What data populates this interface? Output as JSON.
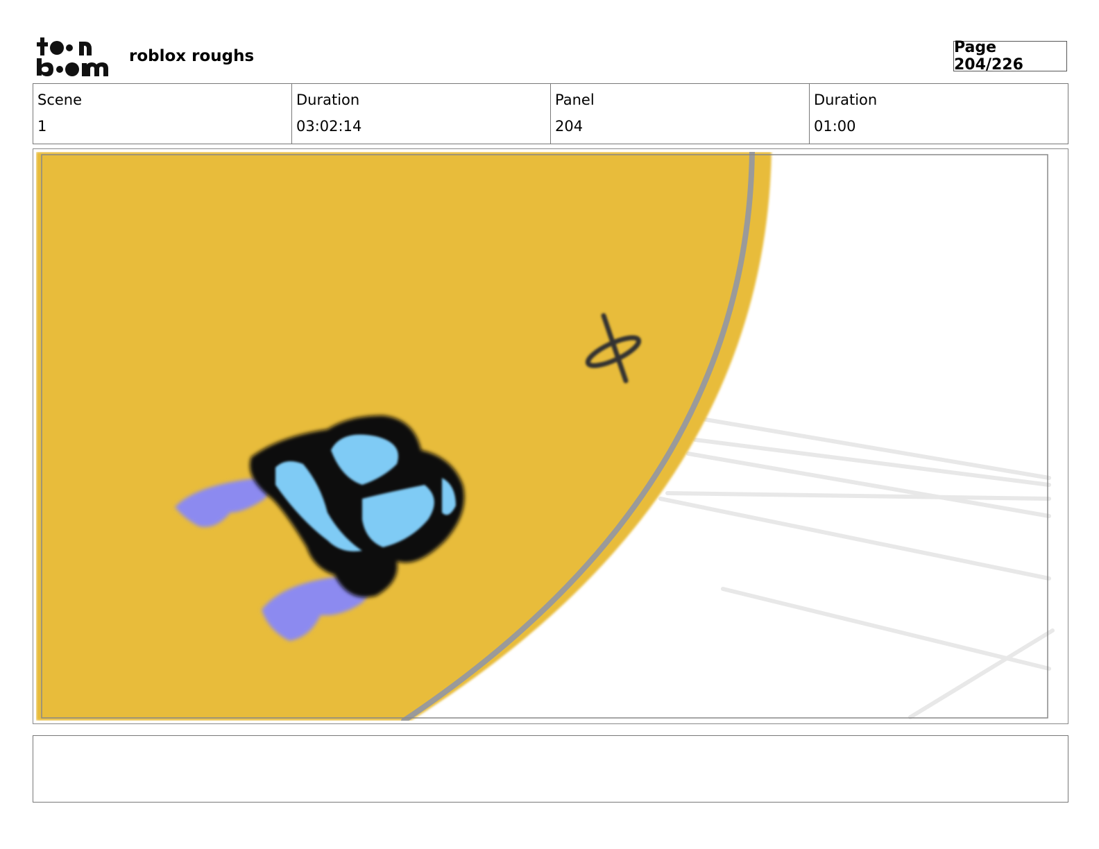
{
  "header": {
    "project_title": "roblox roughs",
    "page_label": "Page 204/226",
    "logo_text": "toonboom"
  },
  "info": [
    {
      "label": "Scene",
      "value": "1"
    },
    {
      "label": "Duration",
      "value": "03:02:14"
    },
    {
      "label": "Panel",
      "value": "204"
    },
    {
      "label": "Duration",
      "value": "01:00"
    }
  ],
  "panel": {
    "colors": {
      "ground": "#E8BC3B",
      "outline": "#111111",
      "body": "#7FCBF5",
      "feet": "#8C8AF0",
      "edge": "#9A9A9A",
      "speed_lines": "#E6E6E6"
    },
    "icons": [
      "character-sketch",
      "x-mark"
    ]
  },
  "notes": ""
}
